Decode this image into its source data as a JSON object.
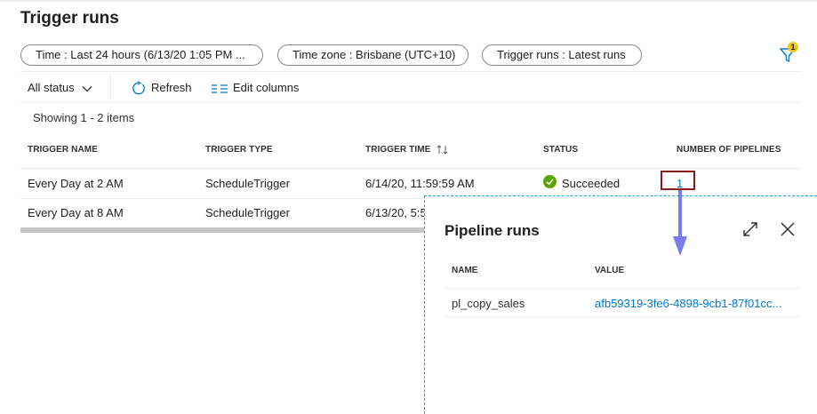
{
  "page": {
    "title": "Trigger runs"
  },
  "filters": {
    "time": "Time : Last 24 hours (6/13/20 1:05 PM ...",
    "timezone": "Time zone : Brisbane (UTC+10)",
    "trigger_runs": "Trigger runs : Latest runs",
    "badge_count": "1"
  },
  "toolbar": {
    "status_label": "All status",
    "refresh_label": "Refresh",
    "edit_columns_label": "Edit columns"
  },
  "table": {
    "showing": "Showing 1 - 2 items",
    "headers": [
      "TRIGGER NAME",
      "TRIGGER TYPE",
      "TRIGGER TIME",
      "STATUS",
      "NUMBER OF PIPELINES"
    ],
    "rows": [
      {
        "name": "Every Day at 2 AM",
        "type": "ScheduleTrigger",
        "time": "6/14/20, 11:59:59 AM",
        "status": "Succeeded",
        "pipelines": "1"
      },
      {
        "name": "Every Day at 8 AM",
        "type": "ScheduleTrigger",
        "time": "6/13/20, 5:5"
      }
    ]
  },
  "panel": {
    "title": "Pipeline runs",
    "headers": [
      "NAME",
      "VALUE"
    ],
    "rows": [
      {
        "name": "pl_copy_sales",
        "value": "afb59319-3fe6-4898-9cb1-87f01cc..."
      }
    ]
  },
  "colors": {
    "accent": "#0078d4",
    "success": "#57a300",
    "highlight": "#8b1a1a",
    "arrow": "#7b7bf0",
    "badge": "#f2c811"
  }
}
